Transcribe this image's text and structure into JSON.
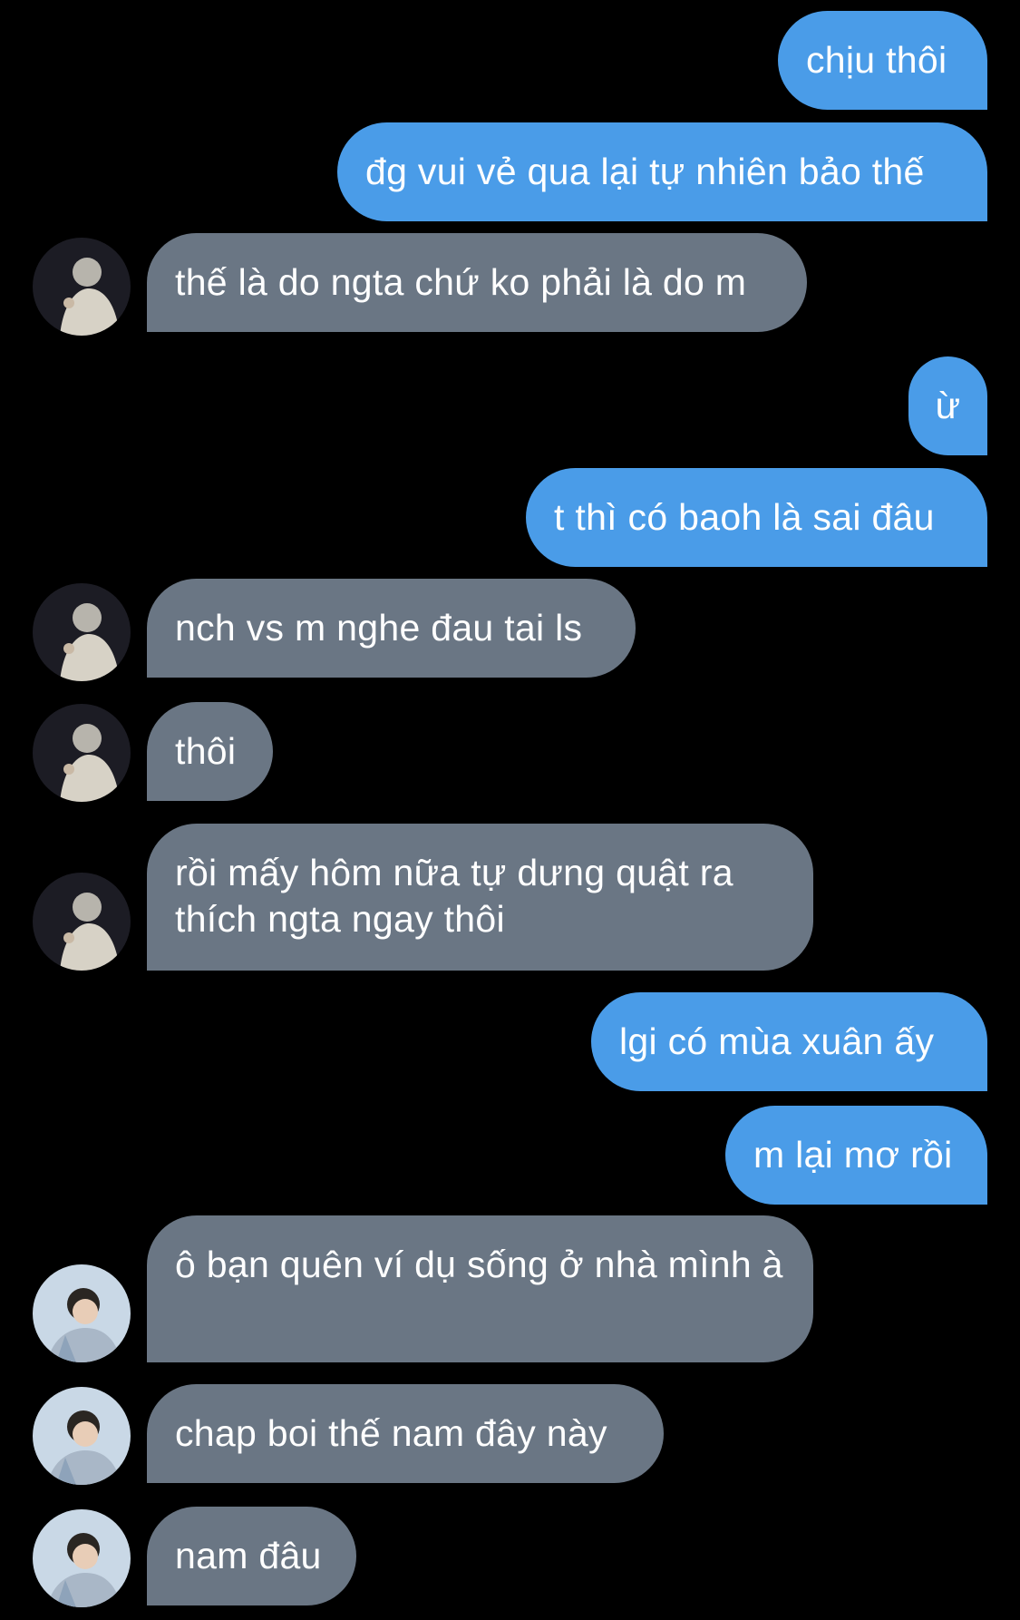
{
  "messages": [
    {
      "side": "sent",
      "text": "chịu thôi"
    },
    {
      "side": "sent",
      "text": "đg vui vẻ qua lại tự nhiên bảo thế"
    },
    {
      "side": "received",
      "avatar": "avatar-a",
      "text": "thế là do ngta chứ ko phải là do m"
    },
    {
      "side": "sent",
      "text": "ừ"
    },
    {
      "side": "sent",
      "text": "t thì có baoh là sai đâu"
    },
    {
      "side": "received",
      "avatar": "avatar-a",
      "text": "nch vs m nghe đau tai ls"
    },
    {
      "side": "received",
      "avatar": "avatar-a",
      "text": "thôi"
    },
    {
      "side": "received",
      "avatar": "avatar-a",
      "text": "rồi mấy hôm nữa tự dưng quật ra thích ngta ngay thôi"
    },
    {
      "side": "sent",
      "text": "lgi có mùa xuân ấy"
    },
    {
      "side": "sent",
      "text": "m lại mơ rồi"
    },
    {
      "side": "received",
      "avatar": "avatar-b",
      "text": "ô bạn quên ví dụ sống ở nhà mình à"
    },
    {
      "side": "received",
      "avatar": "avatar-b",
      "text": "chap boi thế nam đây này"
    },
    {
      "side": "received",
      "avatar": "avatar-b",
      "text": "nam đâu"
    }
  ],
  "colors": {
    "background": "#000000",
    "sent_bubble": "#4a9ce8",
    "received_bubble": "#6a7684",
    "text": "#ffffff"
  }
}
